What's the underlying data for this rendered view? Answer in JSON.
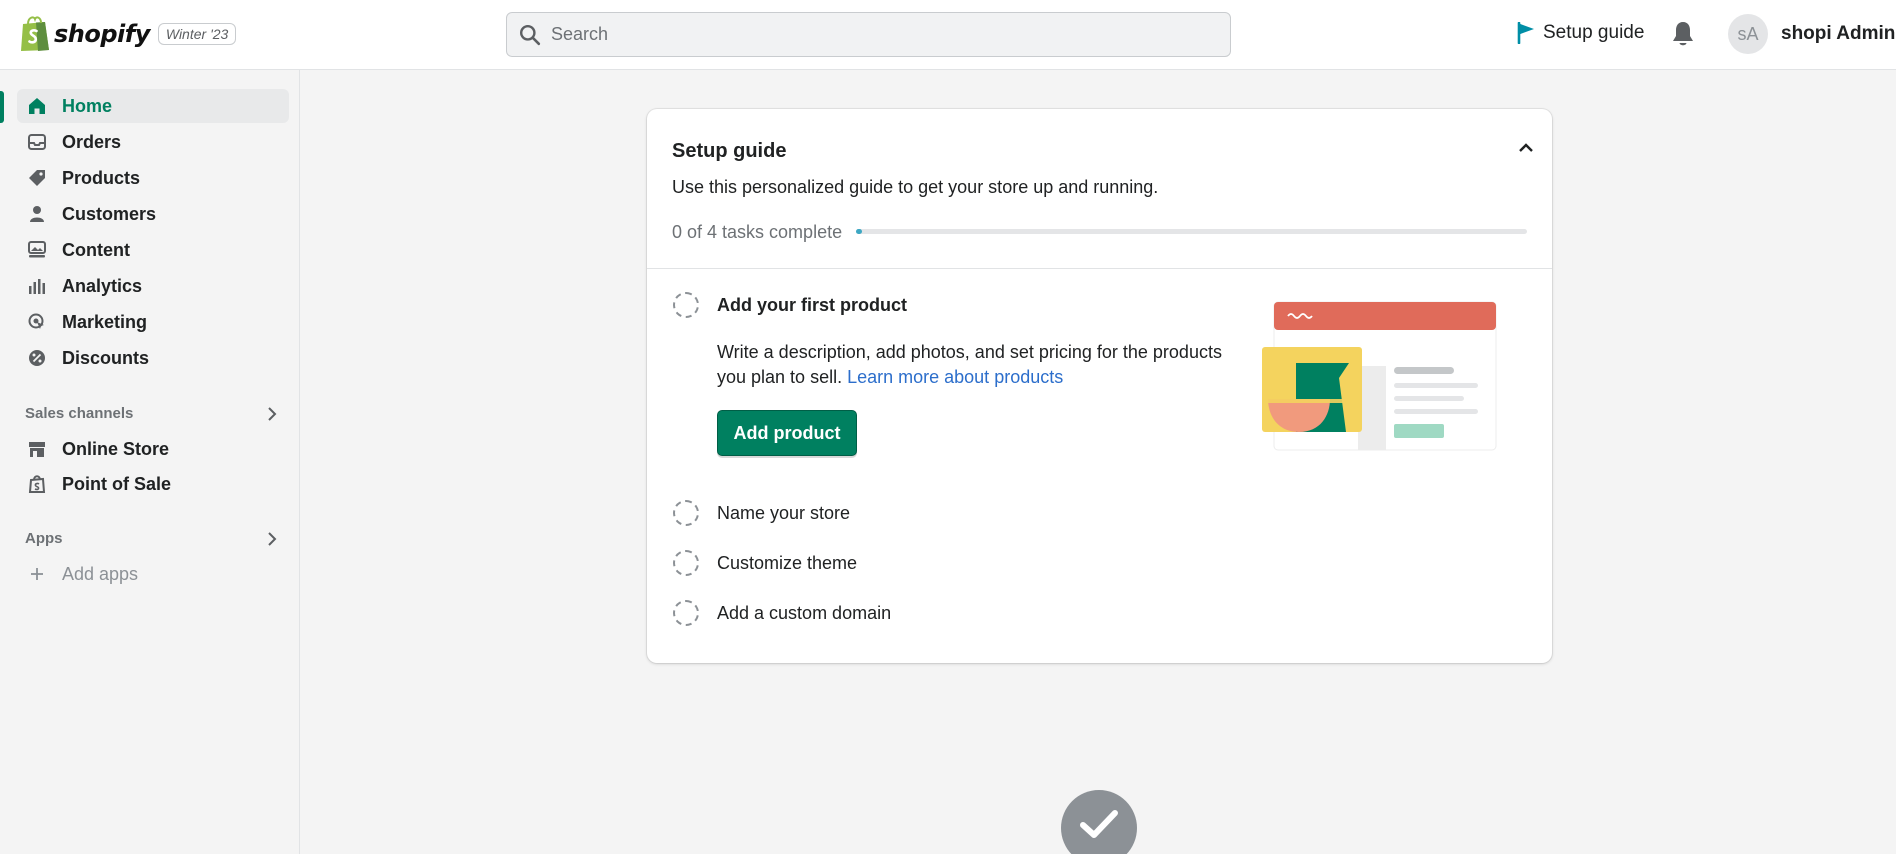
{
  "header": {
    "brand": "shopify",
    "edition_badge": "Winter '23",
    "search_placeholder": "Search",
    "setup_guide_label": "Setup guide",
    "user_initials": "sA",
    "user_name": "shopi Admin"
  },
  "sidebar": {
    "items": [
      {
        "label": "Home",
        "icon": "home-icon",
        "active": true
      },
      {
        "label": "Orders",
        "icon": "inbox-icon"
      },
      {
        "label": "Products",
        "icon": "tag-icon"
      },
      {
        "label": "Customers",
        "icon": "person-icon"
      },
      {
        "label": "Content",
        "icon": "image-icon"
      },
      {
        "label": "Analytics",
        "icon": "bar-chart-icon"
      },
      {
        "label": "Marketing",
        "icon": "target-icon"
      },
      {
        "label": "Discounts",
        "icon": "discount-icon"
      }
    ],
    "sales_channels": {
      "heading": "Sales channels",
      "items": [
        {
          "label": "Online Store",
          "icon": "store-icon"
        },
        {
          "label": "Point of Sale",
          "icon": "pos-bag-icon"
        }
      ]
    },
    "apps": {
      "heading": "Apps",
      "add_label": "Add apps"
    }
  },
  "setup_card": {
    "title": "Setup guide",
    "subtitle": "Use this personalized guide to get your store up and running.",
    "progress_text": "0 of 4 tasks complete",
    "progress_fraction": 0,
    "tasks": [
      {
        "label": "Add your first product",
        "expanded": true,
        "description": "Write a description, add photos, and set pricing for the products you plan to sell.",
        "link": "Learn more about products",
        "button": "Add product"
      },
      {
        "label": "Name your store"
      },
      {
        "label": "Customize theme"
      },
      {
        "label": "Add a custom domain"
      }
    ]
  },
  "colors": {
    "accent_green": "#008060",
    "progress_blue": "#3da7c3",
    "link_blue": "#2c6ecb"
  }
}
